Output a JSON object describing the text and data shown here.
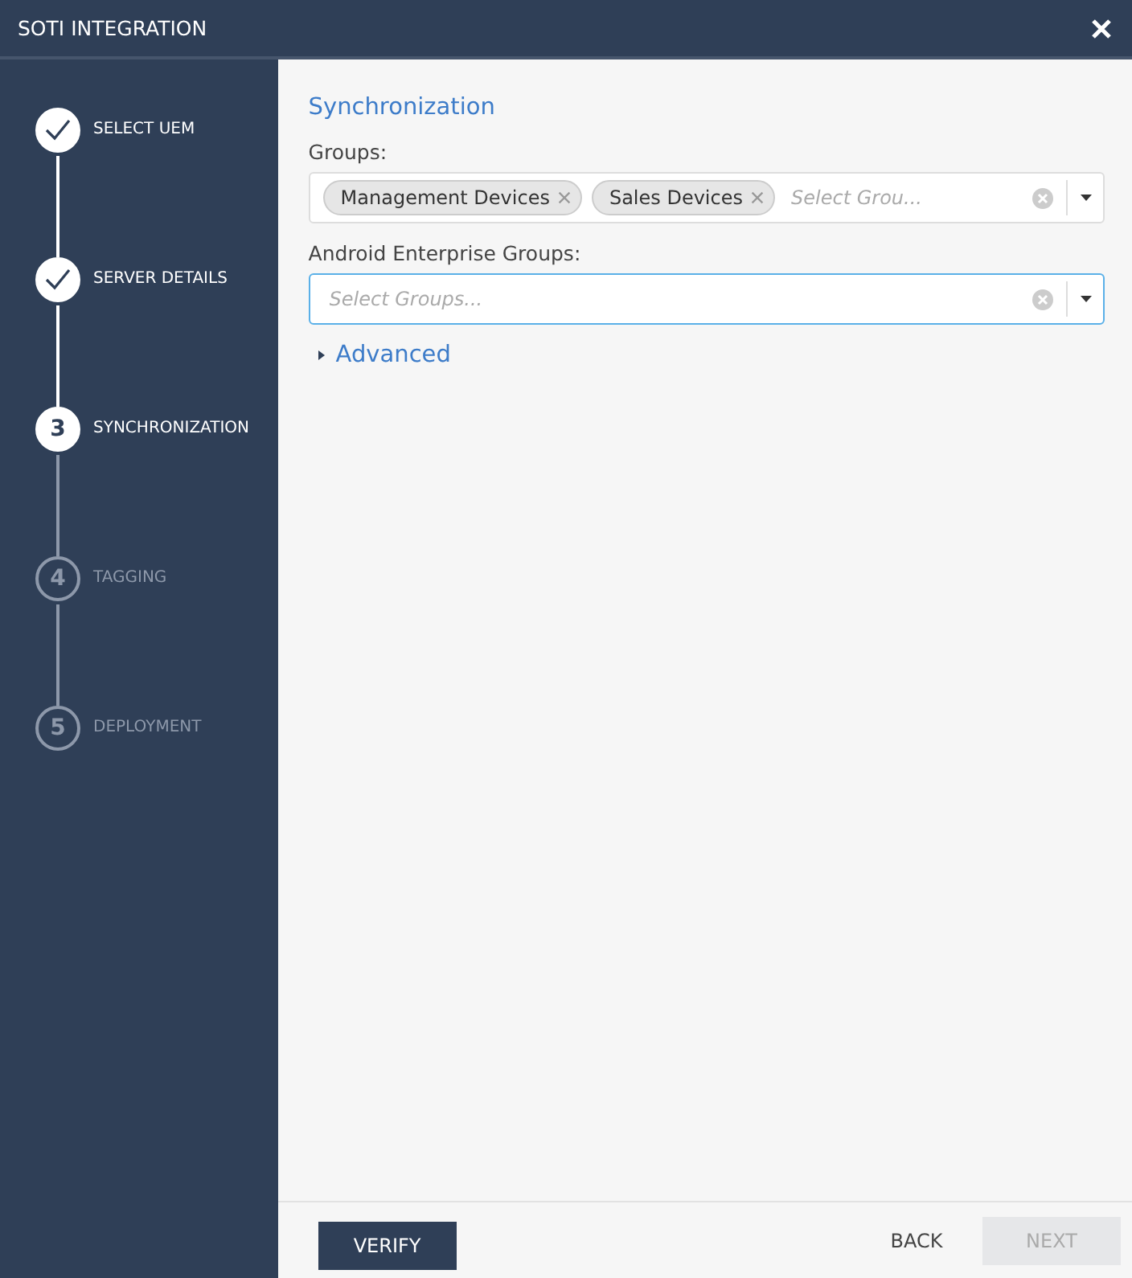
{
  "window": {
    "title": "SOTI INTEGRATION"
  },
  "steps": [
    {
      "label": "SELECT UEM",
      "kind": "done"
    },
    {
      "label": "SERVER DETAILS",
      "kind": "done"
    },
    {
      "label": "SYNCHRONIZATION",
      "kind": "current",
      "number": "3"
    },
    {
      "label": "TAGGING",
      "kind": "pending",
      "number": "4"
    },
    {
      "label": "DEPLOYMENT",
      "kind": "pending",
      "number": "5"
    }
  ],
  "section_title": "Synchronization",
  "fields": [
    {
      "label": "Groups:",
      "tags": [
        "Management Devices",
        "Sales Devices"
      ],
      "placeholder": "Select Grou...",
      "focused": false
    },
    {
      "label": "Android Enterprise Groups:",
      "placeholder": "Select Groups...",
      "focused": true
    }
  ],
  "advanced": {
    "label": "Advanced",
    "expanded": false
  },
  "footer": {
    "verify": "VERIFY",
    "back": "BACK",
    "next": {
      "label": "NEXT",
      "disabled": true
    }
  }
}
